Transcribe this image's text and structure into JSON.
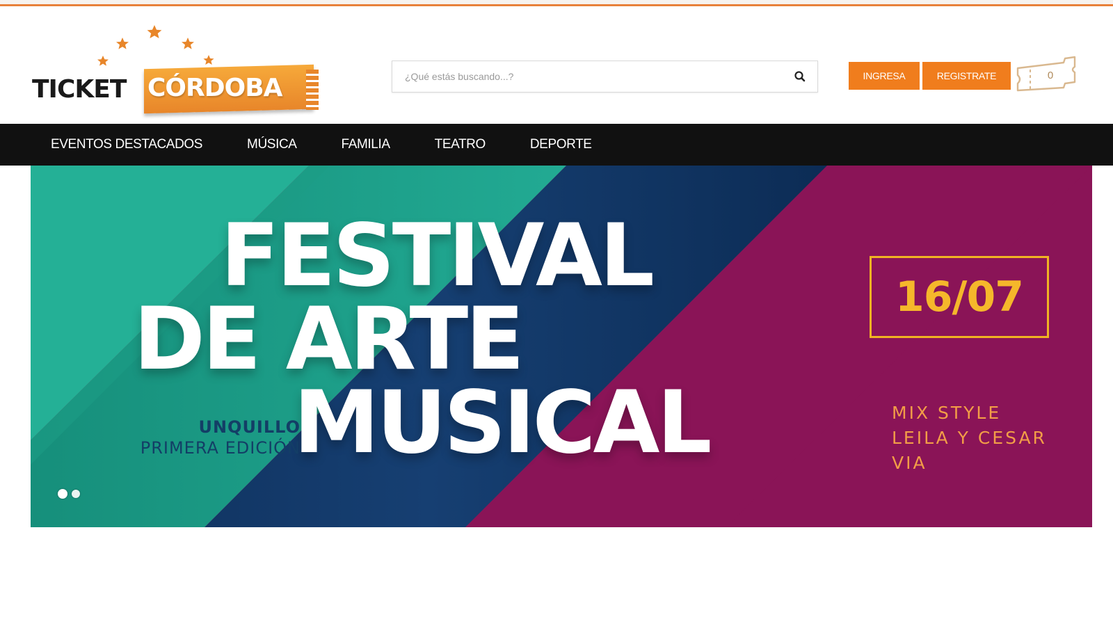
{
  "logo": {
    "word1": "TICKET",
    "word2": "CÓRDOBA"
  },
  "search": {
    "placeholder": "¿Qué estás buscando...?",
    "icon": "search-icon"
  },
  "header": {
    "login_label": "INGRESA",
    "register_label": "REGISTRATE",
    "cart_count": "0",
    "cart_icon": "ticket-icon"
  },
  "nav": {
    "items": [
      {
        "label": "EVENTOS DESTACADOS"
      },
      {
        "label": "MÚSICA"
      },
      {
        "label": "FAMILIA"
      },
      {
        "label": "TEATRO"
      },
      {
        "label": "DEPORTE"
      }
    ]
  },
  "banner": {
    "headline_line1": "FESTIVAL",
    "headline_line2": "DE ARTE",
    "headline_line3": "MUSICAL",
    "location_city": "UNQUILLO",
    "location_edition": "PRIMERA EDICIÓN",
    "date": "16/07",
    "artists": [
      "MIX STYLE",
      "LEILA Y CESAR",
      "VIA"
    ],
    "slide_count": 2,
    "active_slide": 1
  },
  "colors": {
    "accent": "#f07d1d",
    "nav_bg": "#111111",
    "banner_teal": "#23b096",
    "banner_pink": "#e0145a",
    "banner_navy": "#12396a",
    "banner_purple": "#8a1457",
    "date_gold": "#f5b72b"
  }
}
